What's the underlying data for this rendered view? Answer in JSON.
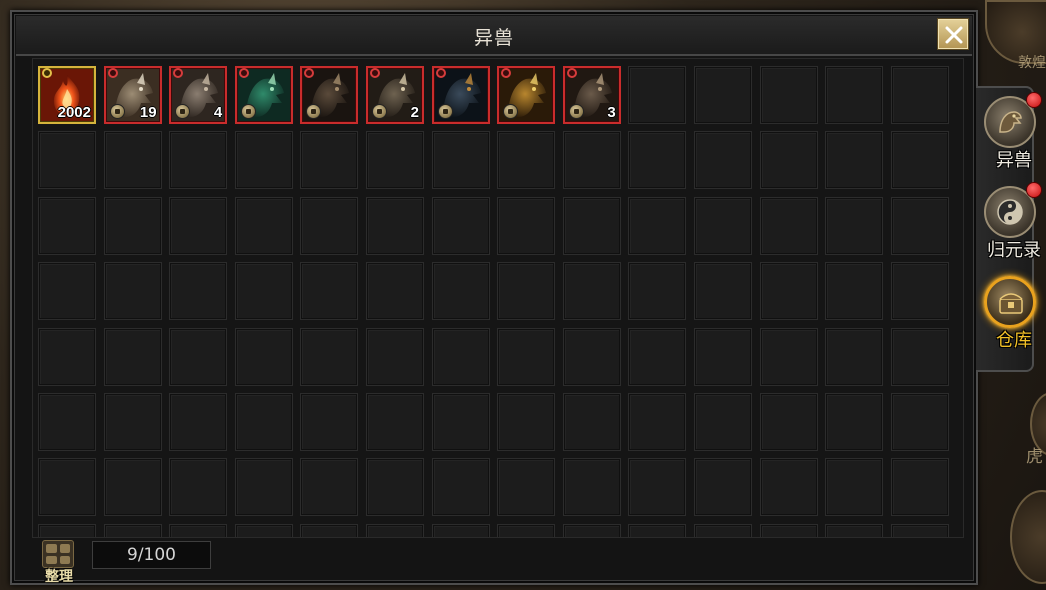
{
  "window": {
    "title": "异兽",
    "close_label": "✕"
  },
  "inventory": {
    "columns": 14,
    "visible_rows": 7,
    "items": [
      {
        "name": "flame-essence",
        "count": "2002",
        "frame": "gold",
        "locked": false
      },
      {
        "name": "beast-white-tiger",
        "count": "19",
        "frame": "red",
        "locked": true
      },
      {
        "name": "beast-grey-wolf",
        "count": "4",
        "frame": "red",
        "locked": true
      },
      {
        "name": "beast-green-dragon",
        "count": "",
        "frame": "red",
        "locked": true
      },
      {
        "name": "beast-black-ox",
        "count": "",
        "frame": "red",
        "locked": true
      },
      {
        "name": "beast-horned-ram",
        "count": "2",
        "frame": "red",
        "locked": true
      },
      {
        "name": "beast-dark-dragon",
        "count": "",
        "frame": "red",
        "locked": true
      },
      {
        "name": "beast-golden-lion",
        "count": "",
        "frame": "red",
        "locked": true
      },
      {
        "name": "beast-stone-boar",
        "count": "3",
        "frame": "red",
        "locked": true
      }
    ]
  },
  "footer": {
    "sort_label": "整理",
    "capacity": "9/100"
  },
  "side_tabs": [
    {
      "name": "tab-beasts",
      "label": "异兽",
      "icon": "dragon-head-icon",
      "active": false,
      "notify": true
    },
    {
      "name": "tab-guiyuanlu",
      "label": "归元录",
      "icon": "yin-yang-icon",
      "active": false,
      "notify": true
    },
    {
      "name": "tab-warehouse",
      "label": "仓库",
      "icon": "chest-icon",
      "active": true,
      "notify": false
    }
  ],
  "background": {
    "labels": [
      "敦煌",
      "虎"
    ]
  },
  "colors": {
    "item_frame": "#c92c2c",
    "gold_frame": "#d6b43c",
    "active_tab": "#f2c128",
    "notify_dot": "#e01515"
  }
}
